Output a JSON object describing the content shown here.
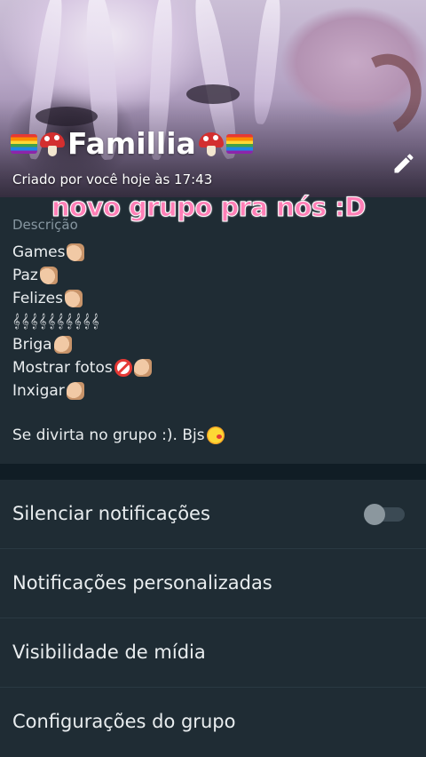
{
  "header": {
    "group_name": "Famillia",
    "created_text": "Criado por você hoje às 17:43",
    "overlay_caption": "novo grupo pra nós :D"
  },
  "description": {
    "label": "Descrição",
    "lines": [
      "Games",
      "Paz",
      "Felizes",
      "𝄞𝄞𝄞𝄞𝄞𝄞𝄞𝄞𝄞𝄞",
      "Briga",
      "Mostrar fotos",
      "Inxigar",
      "Se divirta no grupo :). Bjs"
    ]
  },
  "settings": {
    "mute": "Silenciar notificações",
    "custom_notifications": "Notificações personalizadas",
    "media_visibility": "Visibilidade de mídia",
    "group_settings": "Configurações do grupo",
    "mute_enabled": false
  },
  "icons": {
    "edit": "pencil-icon",
    "flag": "rainbow-flag-icon",
    "mushroom": "mushroom-icon",
    "thumbs_up": "thumbs-up-icon",
    "thumbs_down": "thumbs-down-icon",
    "no_under_18": "no-under-18-icon",
    "kiss_face": "kissing-face-icon"
  },
  "colors": {
    "background": "#101d25",
    "panel": "#1f2c34",
    "caption_pink": "#ff7fb6",
    "secondary_text": "#8696a0"
  }
}
